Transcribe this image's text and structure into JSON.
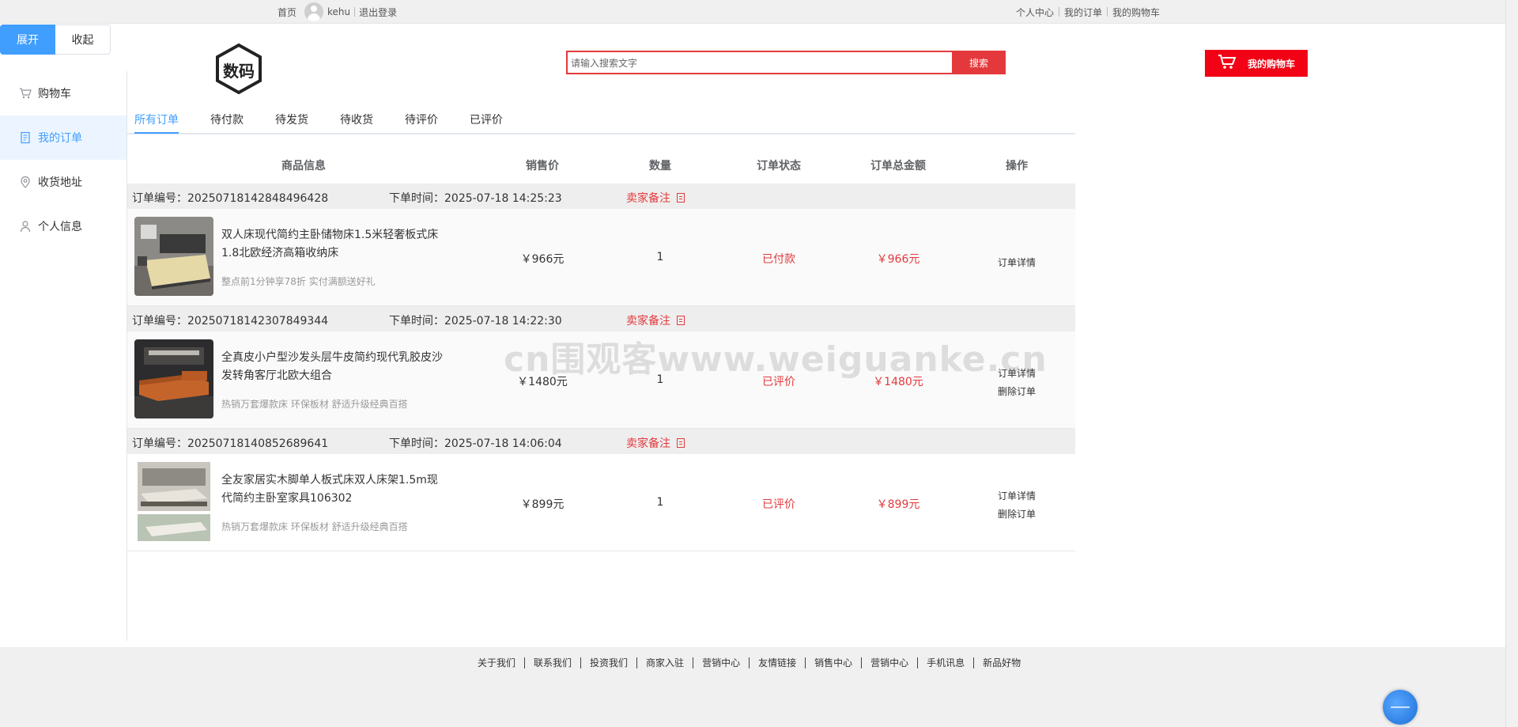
{
  "topbar": {
    "home": "首页",
    "username": "kehu",
    "logout": "退出登录",
    "links": [
      "个人中心",
      "我的订单",
      "我的购物车"
    ]
  },
  "toggle": {
    "expand": "展开",
    "collapse": "收起"
  },
  "sidebar": {
    "items": [
      {
        "label": "购物车",
        "icon": "cart-icon"
      },
      {
        "label": "我的订单",
        "icon": "document-icon",
        "active": true
      },
      {
        "label": "收货地址",
        "icon": "location-icon"
      },
      {
        "label": "个人信息",
        "icon": "user-icon"
      }
    ]
  },
  "logo": {
    "text": "数码"
  },
  "search": {
    "placeholder": "请输入搜索文字",
    "button": "搜索"
  },
  "cart_button": {
    "label": "我的购物车",
    "icon": "cart-icon"
  },
  "tabs": [
    "所有订单",
    "待付款",
    "待发货",
    "待收货",
    "待评价",
    "已评价"
  ],
  "table_header": {
    "product": "商品信息",
    "price": "销售价",
    "qty": "数量",
    "status": "订单状态",
    "total": "订单总金额",
    "ops": "操作"
  },
  "orders": [
    {
      "no": "订单编号：20250718142848496428",
      "time": "下单时间：2025-07-18 14:25:23",
      "note": "卖家备注",
      "title": "双人床现代简约主卧储物床1.5米轻奢板式床1.8北欧经济高箱收纳床",
      "sub": "整点前1分钟享78折 实付满额送好礼",
      "price": "￥966元",
      "qty": "1",
      "status": "已付款",
      "total": "￥966元",
      "ops": [
        "订单详情"
      ]
    },
    {
      "no": "订单编号：20250718142307849344",
      "time": "下单时间：2025-07-18 14:22:30",
      "note": "卖家备注",
      "title": "全真皮小户型沙发头层牛皮简约现代乳胶皮沙发转角客厅北欧大组合",
      "sub": "热销万套爆款床 环保板材 舒适升级经典百搭",
      "price": "￥1480元",
      "qty": "1",
      "status": "已评价",
      "total": "￥1480元",
      "ops": [
        "订单详情",
        "删除订单"
      ]
    },
    {
      "no": "订单编号：20250718140852689641",
      "time": "下单时间：2025-07-18 14:06:04",
      "note": "卖家备注",
      "title": "全友家居实木脚单人板式床双人床架1.5m现代简约主卧室家具106302",
      "sub": "热销万套爆款床 环保板材 舒适升级经典百搭",
      "price": "￥899元",
      "qty": "1",
      "status": "已评价",
      "total": "￥899元",
      "ops": [
        "订单详情",
        "删除订单"
      ]
    }
  ],
  "watermark": "cn围观客www.weiguanke.cn",
  "footer": {
    "links": [
      "关于我们",
      "联系我们",
      "投资我们",
      "商家入驻",
      "营销中心",
      "友情链接",
      "销售中心",
      "营销中心",
      "手机讯息",
      "新品好物"
    ]
  },
  "colors": {
    "accent": "#409eff",
    "brand_red": "#e4393c",
    "cart_red": "#f10215"
  }
}
